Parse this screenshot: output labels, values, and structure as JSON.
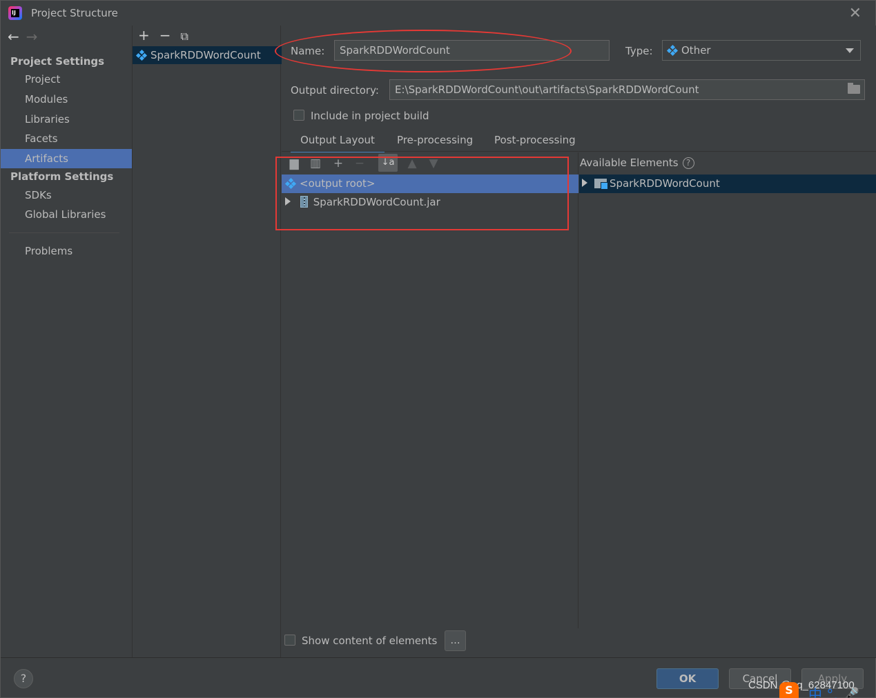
{
  "window": {
    "title": "Project Structure"
  },
  "sidebar": {
    "project_settings_heading": "Project Settings",
    "project_items": [
      "Project",
      "Modules",
      "Libraries",
      "Facets",
      "Artifacts"
    ],
    "selected_item": "Artifacts",
    "platform_settings_heading": "Platform Settings",
    "platform_items": [
      "SDKs",
      "Global Libraries"
    ],
    "problems_label": "Problems"
  },
  "artifact_list": {
    "items": [
      "SparkRDDWordCount"
    ]
  },
  "form": {
    "name_label": "Name:",
    "name_value": "SparkRDDWordCount",
    "type_label": "Type:",
    "type_value": "Other",
    "output_dir_label": "Output directory:",
    "output_dir_value": "E:\\SparkRDDWordCount\\out\\artifacts\\SparkRDDWordCount",
    "include_build_label": "Include in project build",
    "include_build_checked": false
  },
  "tabs": [
    {
      "label": "Output Layout",
      "active": true
    },
    {
      "label": "Pre-processing",
      "active": false
    },
    {
      "label": "Post-processing",
      "active": false
    }
  ],
  "output_layout": {
    "tree": [
      {
        "label": "<output root>",
        "selected": true,
        "icon": "artifact-icon"
      },
      {
        "label": "SparkRDDWordCount.jar",
        "selected": false,
        "icon": "jar-icon",
        "expandable": true
      }
    ]
  },
  "available_elements": {
    "title": "Available Elements",
    "items": [
      {
        "label": "SparkRDDWordCount",
        "icon": "module-folder-icon",
        "expandable": true
      }
    ]
  },
  "bottom": {
    "show_content_label": "Show content of elements",
    "ellipsis_label": "...",
    "ok_label": "OK",
    "cancel_label": "Cancel",
    "apply_label": "Apply",
    "help_label": "?"
  },
  "overlay": {
    "watermark": "CSDN @qq_62847100",
    "ime_glyphs": "中 °, 🎤"
  },
  "colors": {
    "background": "#3c3f41",
    "selection": "#4b6eaf",
    "annotation_red": "#e53935",
    "primary_button": "#365880"
  }
}
